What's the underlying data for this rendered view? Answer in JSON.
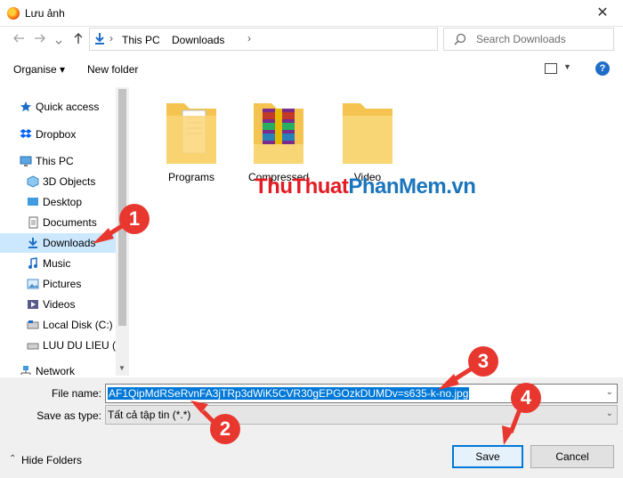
{
  "window": {
    "title": "Lưu ảnh",
    "close_glyph": "✕"
  },
  "nav": {
    "back_icon": "arrow-left-icon",
    "forward_icon": "arrow-right-icon",
    "recent_icon": "chevron-down-icon",
    "up_icon": "arrow-up-icon",
    "breadcrumb": [
      "This PC",
      "Downloads"
    ],
    "search_placeholder": "Search Downloads"
  },
  "toolbar": {
    "organise_label": "Organise ▾",
    "new_folder_label": "New folder",
    "help_label": "?"
  },
  "sidebar": {
    "items": [
      {
        "label": "Quick access",
        "icon": "star-icon"
      },
      {
        "label": "Dropbox",
        "icon": "dropbox-icon"
      },
      {
        "label": "This PC",
        "icon": "computer-icon"
      },
      {
        "label": "3D Objects",
        "icon": "cube-icon"
      },
      {
        "label": "Desktop",
        "icon": "desktop-icon"
      },
      {
        "label": "Documents",
        "icon": "document-icon"
      },
      {
        "label": "Downloads",
        "icon": "download-icon",
        "selected": true
      },
      {
        "label": "Music",
        "icon": "music-icon"
      },
      {
        "label": "Pictures",
        "icon": "picture-icon"
      },
      {
        "label": "Videos",
        "icon": "video-icon"
      },
      {
        "label": "Local Disk (C:)",
        "icon": "disk-icon"
      },
      {
        "label": "LUU DU LIEU (D:",
        "icon": "drive-icon"
      },
      {
        "label": "Network",
        "icon": "network-icon"
      }
    ]
  },
  "files": [
    {
      "name": "Programs",
      "icon": "folder-icon"
    },
    {
      "name": "Compressed",
      "icon": "winrar-icon"
    },
    {
      "name": "Video",
      "icon": "folder-icon"
    }
  ],
  "watermark": {
    "part1": "Thu",
    "part2": "Thuat",
    "part3": "Phan",
    "part4": "Mem",
    "part5": ".vn"
  },
  "form": {
    "file_name_label": "File name:",
    "file_name_value": "AF1QipMdRSeRvnFA3jTRp3dWiK5CVR30gEPGOzkDUMDv=s635-k-no.jpg",
    "save_as_type_label": "Save as type:",
    "save_as_type_value": "Tất cả tập tin (*.*)",
    "hide_folders_label": "Hide Folders",
    "save_label": "Save",
    "cancel_label": "Cancel"
  },
  "annotations": [
    "1",
    "2",
    "3",
    "4"
  ],
  "colors": {
    "selection": "#cce8ff",
    "accent": "#0078d7",
    "marker": "#e8372f",
    "folder": "#f5c450"
  }
}
